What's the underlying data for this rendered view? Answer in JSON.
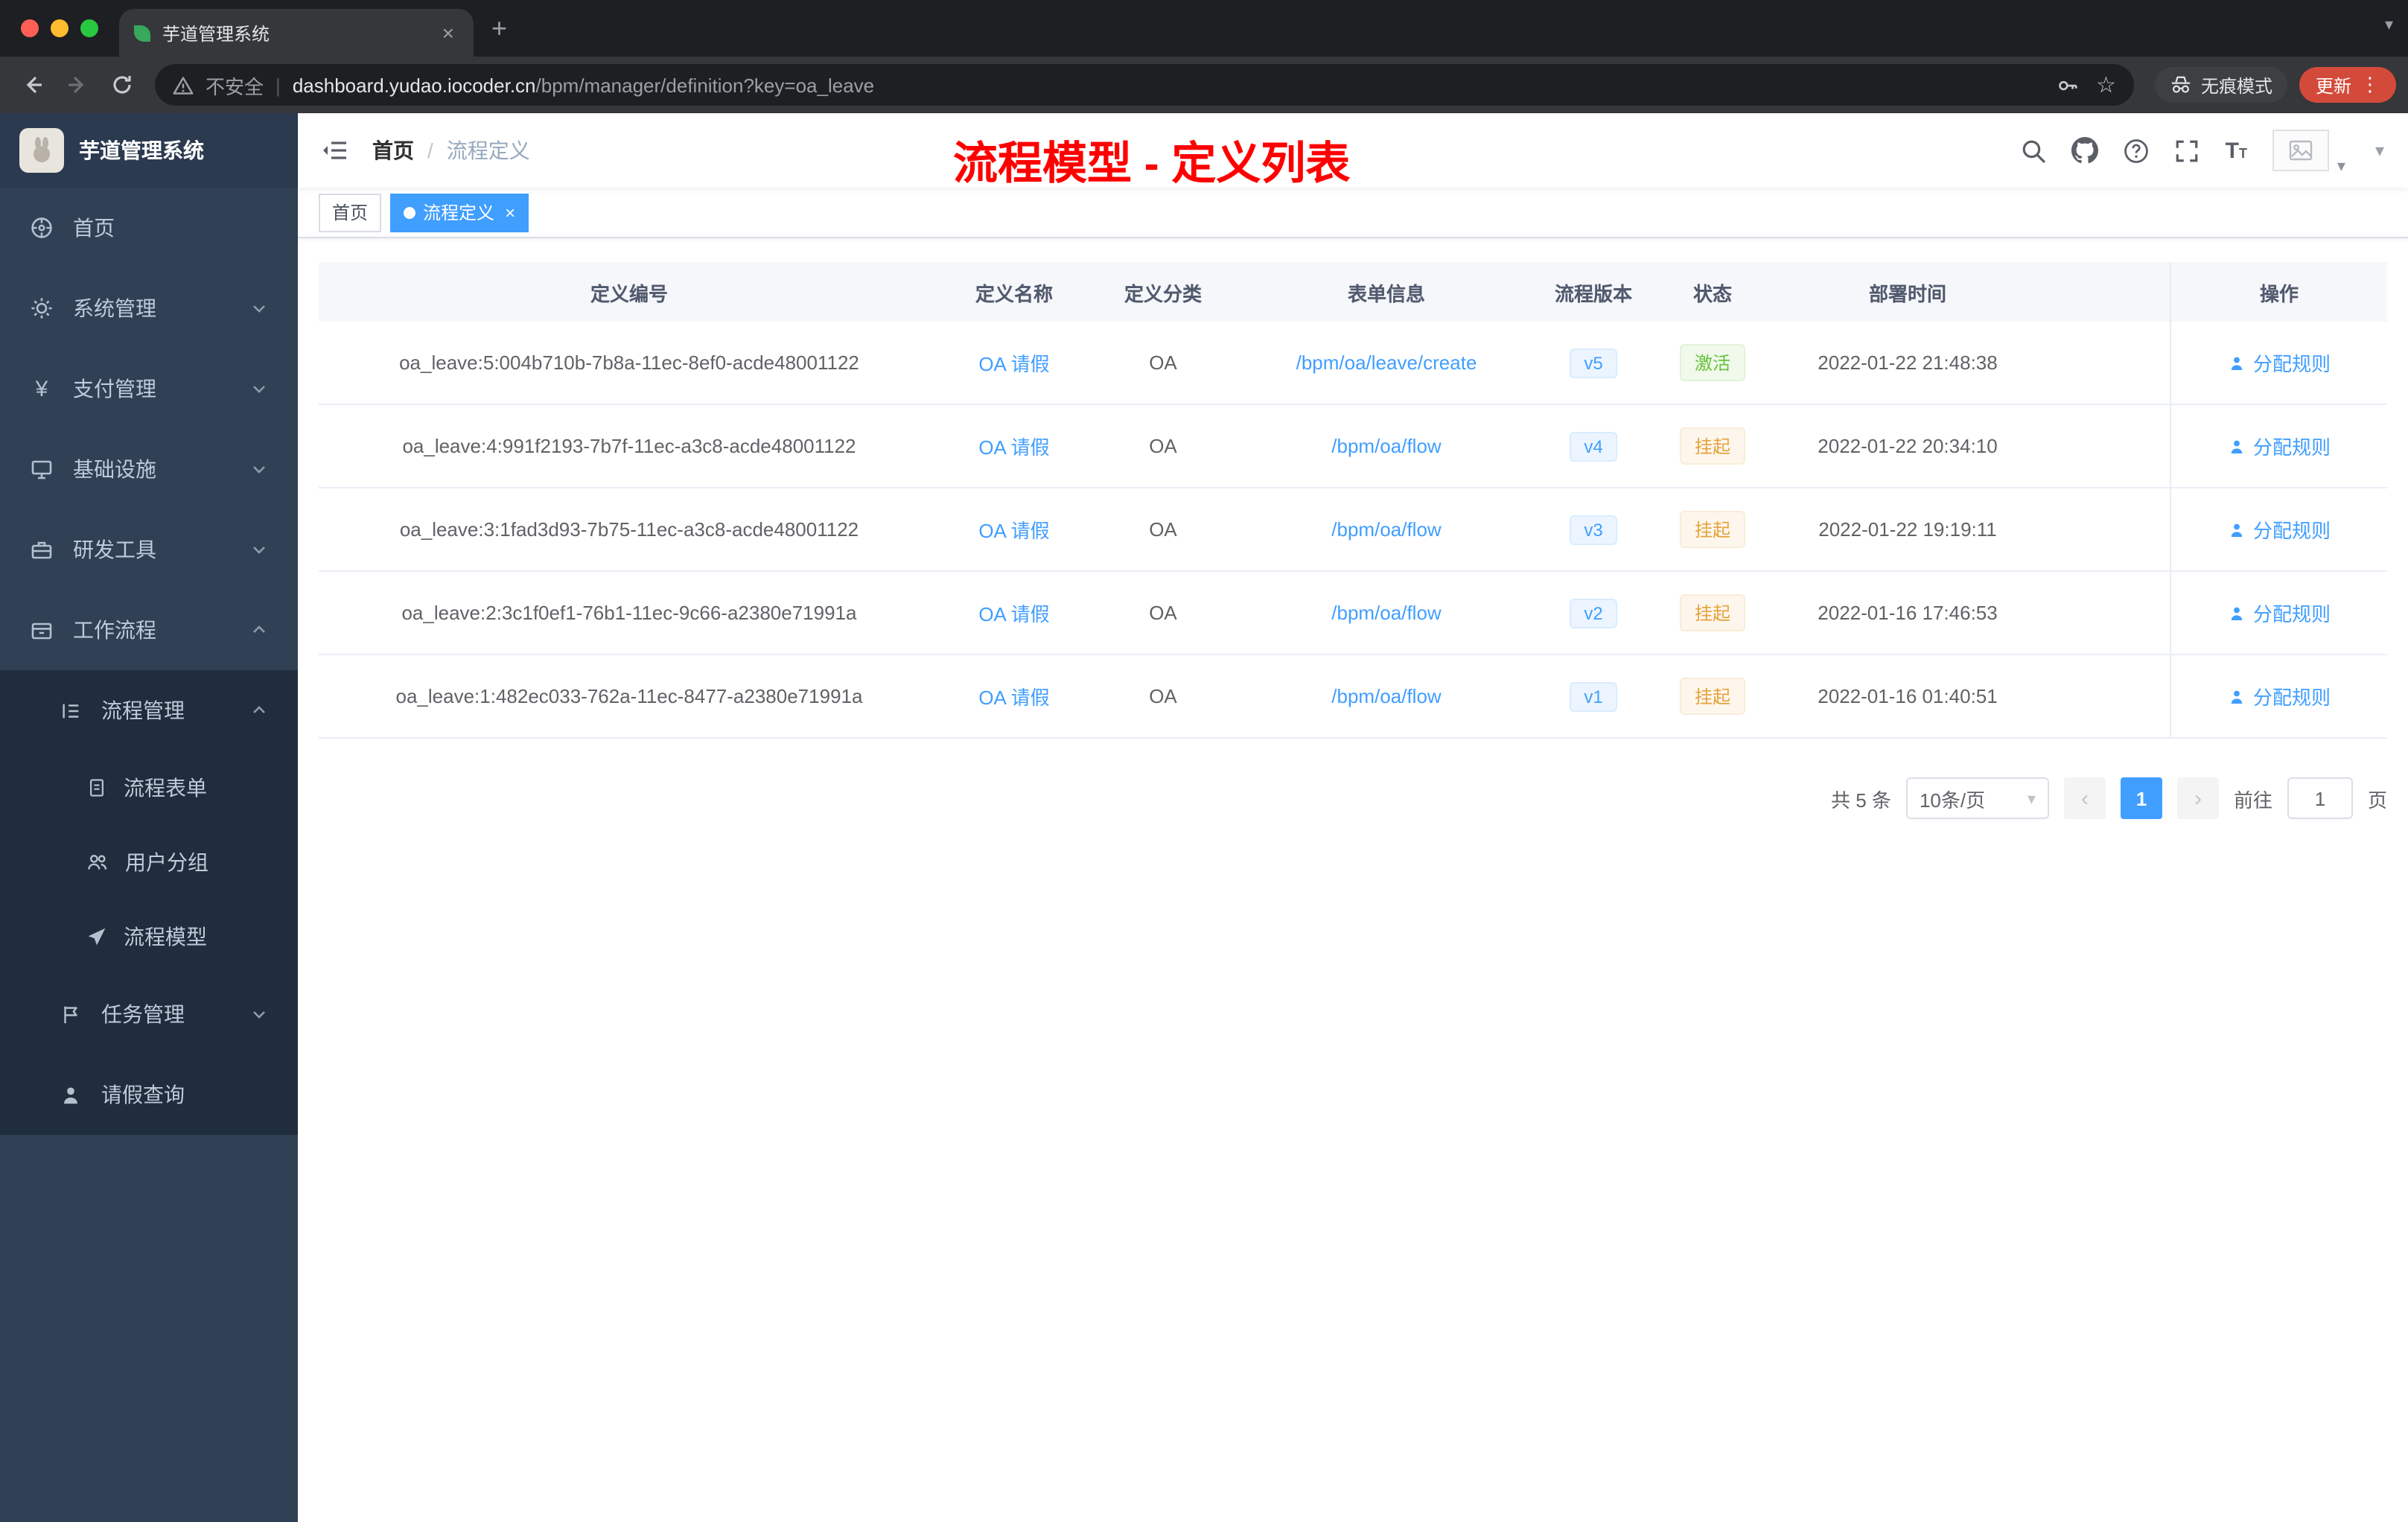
{
  "colors": {
    "accent": "#409eff",
    "success": "#67c23a",
    "warning": "#e6a23c",
    "overlay_title_red": "#ff0000",
    "sidebar_bg": "#304156",
    "submenu_bg": "#1f2d3d"
  },
  "icons": {
    "close": "×",
    "plus": "+",
    "kebab": "⋮",
    "star": "☆",
    "chevron_down": "▾",
    "prev": "‹",
    "next": "›",
    "yen": "¥"
  },
  "browser": {
    "tab_title": "芋道管理系统",
    "security_label": "不安全",
    "url_domain": "dashboard.yudao.iocoder.cn",
    "url_path": "/bpm/manager/definition?key=oa_leave",
    "incognito_label": "无痕模式",
    "update_label": "更新"
  },
  "sidebar": {
    "app_title": "芋道管理系统",
    "menu": [
      {
        "label": "首页"
      },
      {
        "label": "系统管理"
      },
      {
        "label": "支付管理"
      },
      {
        "label": "基础设施"
      },
      {
        "label": "研发工具"
      },
      {
        "label": "工作流程"
      }
    ],
    "sub": [
      {
        "label": "流程管理"
      },
      {
        "label": "流程表单"
      },
      {
        "label": "用户分组"
      },
      {
        "label": "流程模型"
      },
      {
        "label": "任务管理"
      },
      {
        "label": "请假查询"
      }
    ]
  },
  "header": {
    "breadcrumb_root": "首页",
    "breadcrumb_sep": "/",
    "breadcrumb_current": "流程定义",
    "overlay_title": "流程模型 - 定义列表"
  },
  "tags_view": {
    "home": "首页",
    "active": "流程定义"
  },
  "table": {
    "columns": [
      "定义编号",
      "定义名称",
      "定义分类",
      "表单信息",
      "流程版本",
      "状态",
      "部署时间",
      "操作"
    ],
    "rows": [
      {
        "id": "oa_leave:5:004b710b-7b8a-11ec-8ef0-acde48001122",
        "name": "OA 请假",
        "category": "OA",
        "form": "/bpm/oa/leave/create",
        "version": "v5",
        "status": "激活",
        "status_type": "success",
        "time": "2022-01-22 21:48:38",
        "action": "分配规则"
      },
      {
        "id": "oa_leave:4:991f2193-7b7f-11ec-a3c8-acde48001122",
        "name": "OA 请假",
        "category": "OA",
        "form": "/bpm/oa/flow",
        "version": "v4",
        "status": "挂起",
        "status_type": "warning",
        "time": "2022-01-22 20:34:10",
        "action": "分配规则"
      },
      {
        "id": "oa_leave:3:1fad3d93-7b75-11ec-a3c8-acde48001122",
        "name": "OA 请假",
        "category": "OA",
        "form": "/bpm/oa/flow",
        "version": "v3",
        "status": "挂起",
        "status_type": "warning",
        "time": "2022-01-22 19:19:11",
        "action": "分配规则"
      },
      {
        "id": "oa_leave:2:3c1f0ef1-76b1-11ec-9c66-a2380e71991a",
        "name": "OA 请假",
        "category": "OA",
        "form": "/bpm/oa/flow",
        "version": "v2",
        "status": "挂起",
        "status_type": "warning",
        "time": "2022-01-16 17:46:53",
        "action": "分配规则"
      },
      {
        "id": "oa_leave:1:482ec033-762a-11ec-8477-a2380e71991a",
        "name": "OA 请假",
        "category": "OA",
        "form": "/bpm/oa/flow",
        "version": "v1",
        "status": "挂起",
        "status_type": "warning",
        "time": "2022-01-16 01:40:51",
        "action": "分配规则"
      }
    ]
  },
  "pagination": {
    "total": "共 5 条",
    "page_size": "10条/页",
    "current_page": "1",
    "goto_label": "前往",
    "goto_value": "1",
    "page_unit": "页"
  }
}
